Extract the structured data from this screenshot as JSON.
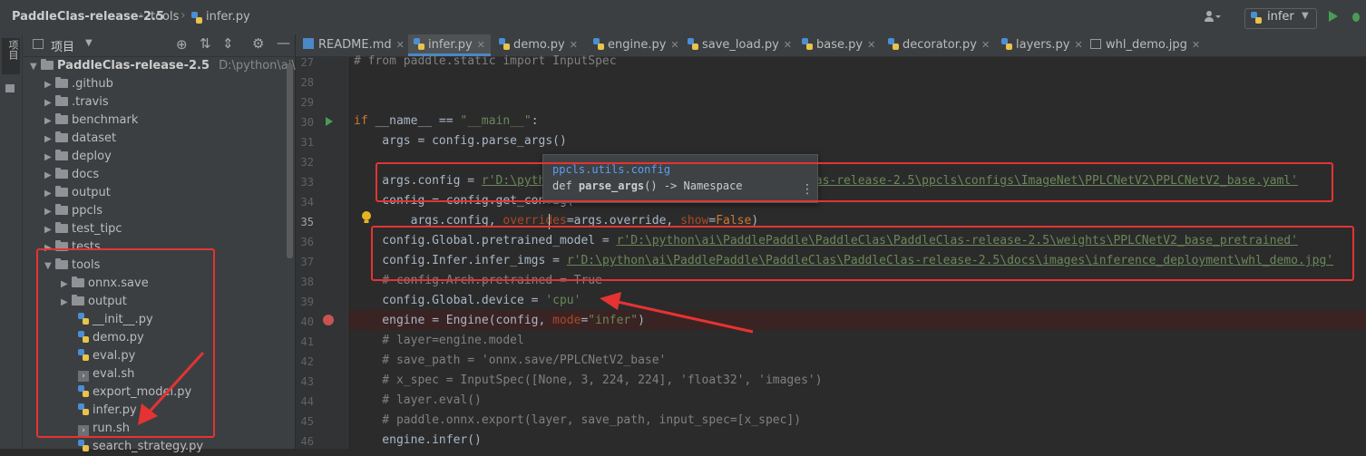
{
  "breadcrumb": {
    "project": "PaddleClas-release-2.5",
    "folder": "tools",
    "file": "infer.py"
  },
  "run_config": {
    "label": "infer"
  },
  "left_strip": {
    "label": "项目"
  },
  "project_panel": {
    "title": "项目",
    "tree": [
      {
        "label": "PaddleClas-release-2.5",
        "path": "D:\\python\\ai\\Paddle",
        "kind": "root"
      },
      {
        "label": ".github",
        "kind": "folder"
      },
      {
        "label": ".travis",
        "kind": "folder"
      },
      {
        "label": "benchmark",
        "kind": "folder"
      },
      {
        "label": "dataset",
        "kind": "folder"
      },
      {
        "label": "deploy",
        "kind": "folder"
      },
      {
        "label": "docs",
        "kind": "folder"
      },
      {
        "label": "output",
        "kind": "folder"
      },
      {
        "label": "ppcls",
        "kind": "folder"
      },
      {
        "label": "test_tipc",
        "kind": "folder"
      },
      {
        "label": "tests",
        "kind": "folder"
      },
      {
        "label": "tools",
        "kind": "folder-open"
      },
      {
        "label": "onnx.save",
        "kind": "folder"
      },
      {
        "label": "output",
        "kind": "folder"
      },
      {
        "label": "__init__.py",
        "kind": "py"
      },
      {
        "label": "demo.py",
        "kind": "py"
      },
      {
        "label": "eval.py",
        "kind": "py"
      },
      {
        "label": "eval.sh",
        "kind": "sh"
      },
      {
        "label": "export_model.py",
        "kind": "py"
      },
      {
        "label": "infer.py",
        "kind": "py"
      },
      {
        "label": "run.sh",
        "kind": "sh"
      },
      {
        "label": "search_strategy.py",
        "kind": "py"
      }
    ]
  },
  "tabs": [
    {
      "label": "README.md",
      "active": false
    },
    {
      "label": "infer.py",
      "active": true
    },
    {
      "label": "demo.py",
      "active": false
    },
    {
      "label": "engine.py",
      "active": false
    },
    {
      "label": "save_load.py",
      "active": false
    },
    {
      "label": "base.py",
      "active": false
    },
    {
      "label": "decorator.py",
      "active": false
    },
    {
      "label": "layers.py",
      "active": false
    },
    {
      "label": "whl_demo.jpg",
      "active": false
    }
  ],
  "editor": {
    "line_numbers": [
      "27",
      "28",
      "29",
      "30",
      "31",
      "32",
      "33",
      "34",
      "35",
      "36",
      "37",
      "38",
      "39",
      "40",
      "41",
      "42",
      "43",
      "44",
      "45",
      "46"
    ],
    "code": {
      "l27": "# from paddle.static import InputSpec",
      "l30_if": "if",
      "l30_mid": " __name__ == ",
      "l30_str": "\"__main__\"",
      "l30_end": ":",
      "l31": "    args = config.parse_args()",
      "l33_a": "    args.config = ",
      "l33_str": "r'D:\\python\\ai\\PaddlePaddle\\PaddleClas\\PaddleClas-release-2.5\\ppcls\\configs\\ImageNet\\PPLCNetV2\\PPLCNetV2_base.yaml'",
      "l34": "    config = config.get_config(",
      "l35_a": "        args.config, ",
      "l35_p1": "overrides",
      "l35_b": "=args.override, ",
      "l35_p2": "show",
      "l35_c": "=",
      "l35_kw": "False",
      "l35_d": ")",
      "l36_a": "    config.Global.pretrained_model = ",
      "l36_str": "r'D:\\python\\ai\\PaddlePaddle\\PaddleClas\\PaddleClas-release-2.5\\weights\\PPLCNetV2_base_pretrained'",
      "l37_a": "    config.Infer.infer_imgs = ",
      "l37_str": "r'D:\\python\\ai\\PaddlePaddle\\PaddleClas\\PaddleClas-release-2.5\\docs\\images\\inference_deployment\\whl_demo.jpg'",
      "l38": "    # config.Arch.pretrained = True",
      "l39_a": "    config.Global.device = ",
      "l39_str": "'cpu'",
      "l40_a": "    engine = Engine(config, ",
      "l40_p": "mode",
      "l40_b": "=",
      "l40_str": "\"infer\"",
      "l40_c": ")",
      "l41": "    # layer=engine.model",
      "l42": "    # save_path = 'onnx.save/PPLCNetV2_base'",
      "l43": "    # x_spec = InputSpec([None, 3, 224, 224], 'float32', 'images')",
      "l44": "    # layer.eval()",
      "l45": "    # paddle.onnx.export(layer, save_path, input_spec=[x_spec])",
      "l46_a": "    engine.infer()"
    }
  },
  "popup": {
    "module": "ppcls.utils.config",
    "signature_def": "def ",
    "signature_name": "parse_args",
    "signature_rest": "() -> Namespace"
  },
  "colors": {
    "accent": "#4a88c7",
    "annotation_red": "#e53333",
    "breakpoint": "#c75450",
    "run_green": "#499c54"
  }
}
